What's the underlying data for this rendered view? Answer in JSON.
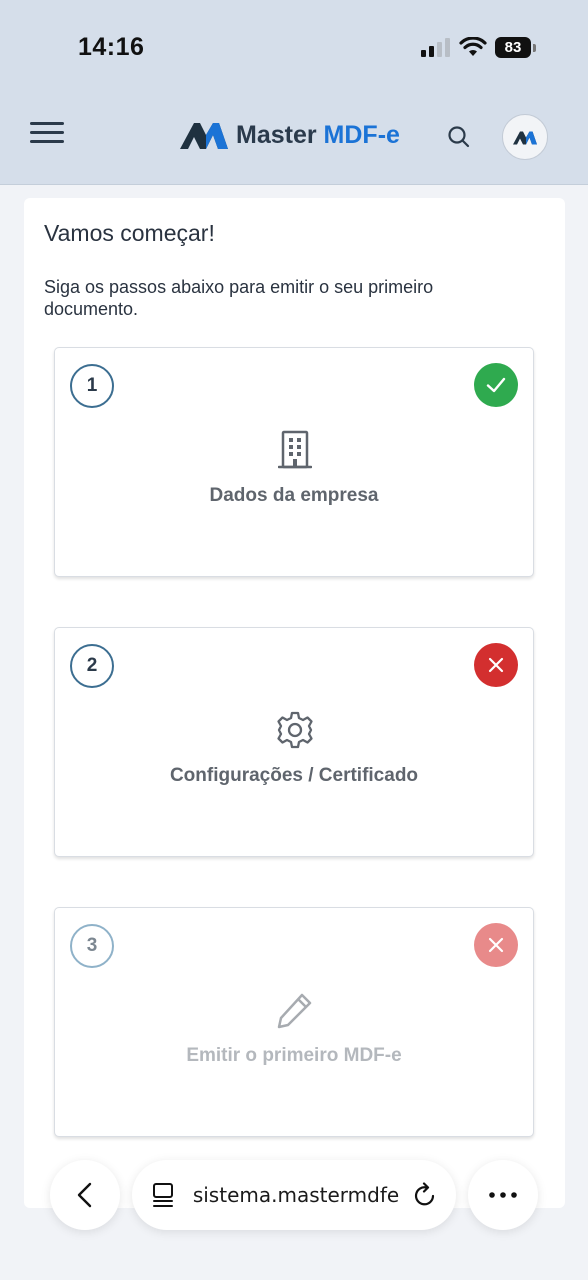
{
  "status_bar": {
    "time": "14:16",
    "battery": "83"
  },
  "header": {
    "logo_text_part1": "Master",
    "logo_text_part2": "MDF-e",
    "menu_icon": "hamburger-menu-icon",
    "search_icon": "search-icon"
  },
  "page": {
    "title": "Vamos começar!",
    "subtitle": "Siga os passos abaixo para emitir o seu primeiro documento."
  },
  "steps": [
    {
      "number": "1",
      "label": "Dados da empresa",
      "icon": "building-icon",
      "status": "complete",
      "status_color": "#2faa4f"
    },
    {
      "number": "2",
      "label": "Configurações / Certificado",
      "icon": "gear-icon",
      "status": "incomplete",
      "status_color": "#d32f2f"
    },
    {
      "number": "3",
      "label": "Emitir o primeiro MDF-e",
      "icon": "pencil-icon",
      "status": "disabled",
      "status_color": "#e88a8a"
    }
  ],
  "browser": {
    "url": "sistema.mastermdfe"
  },
  "colors": {
    "header_bg": "#d5deea",
    "brand_blue": "#1b73d6",
    "brand_dark": "#2a3a4c"
  }
}
